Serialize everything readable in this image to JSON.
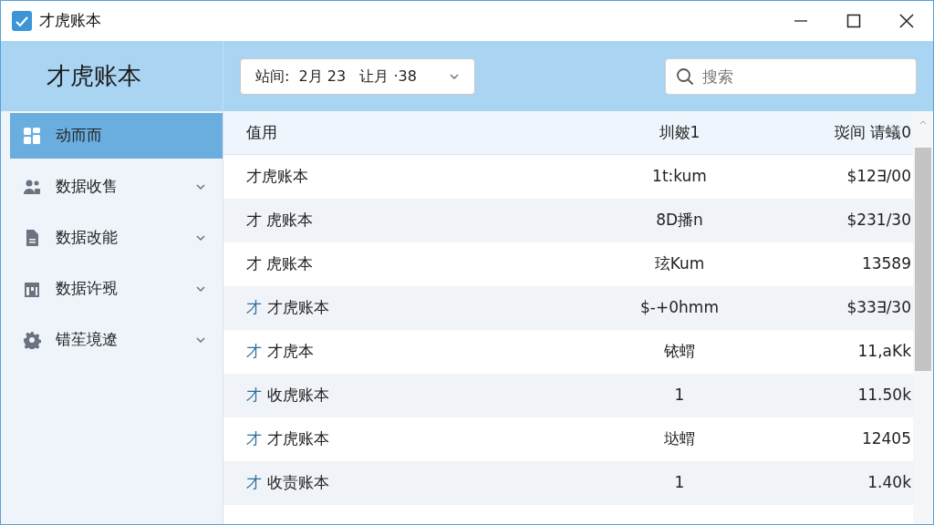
{
  "window": {
    "title": "才虎账本"
  },
  "header": {
    "app_name": "才虎账本",
    "date_filter": "站间:  2月 23   让月 ·38",
    "search": {
      "placeholder": "搜索"
    }
  },
  "sidebar": {
    "items": [
      {
        "label": "动而而",
        "kind": "grid",
        "selected": true
      },
      {
        "label": "数据收售",
        "kind": "people",
        "selected": false
      },
      {
        "label": "数据改能",
        "kind": "document",
        "selected": false
      },
      {
        "label": "数据许覡",
        "kind": "calendar",
        "selected": false
      },
      {
        "label": "错苼境遼",
        "kind": "gear",
        "selected": false
      }
    ]
  },
  "table": {
    "columns": [
      "值用",
      "圳皴1",
      "珳间 请蟻0"
    ],
    "rows": [
      {
        "name": "才虎账本",
        "column_2": "1t:kum",
        "column_3": "$12∃/00"
      },
      {
        "name": "才 虎账本",
        "column_2": "8D播n",
        "column_3": "$231/30"
      },
      {
        "name": "才 虎账本",
        "column_2": "玹Kum",
        "column_3": "13589"
      },
      {
        "prefix": "才",
        "name": "才虎账本",
        "column_2": "$-+0hmm",
        "column_3": "$33∃/30"
      },
      {
        "prefix": "才",
        "name": "才虎本",
        "column_2": "铱蝟",
        "column_3": "11,aKk"
      },
      {
        "prefix": "才",
        "name": "收虎账本",
        "column_2": "1",
        "column_3": "11.50k"
      },
      {
        "prefix": "才",
        "name": "才虎账本",
        "column_2": "垯蝟",
        "column_3": "12405"
      },
      {
        "prefix": "才",
        "name": "收责账本",
        "column_2": "1",
        "column_3": "1.40k"
      }
    ]
  }
}
